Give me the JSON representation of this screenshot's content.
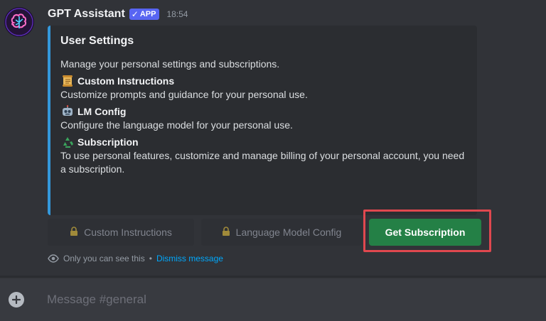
{
  "message": {
    "author": "GPT Assistant",
    "badge": "APP",
    "badge_check": "✓",
    "timestamp": "18:54"
  },
  "embed": {
    "accent_color": "#3498db",
    "title": "User Settings",
    "description": "Manage your personal settings and subscriptions.",
    "sections": [
      {
        "icon": "scroll-icon",
        "title": "Custom Instructions",
        "text": "Customize prompts and guidance for your personal use."
      },
      {
        "icon": "robot-icon",
        "title": "LM Config",
        "text": "Configure the language model for your personal use."
      },
      {
        "icon": "recycle-icon",
        "title": "Subscription",
        "text": "To use personal features, customize and manage billing of your personal account, you need a subscription."
      }
    ]
  },
  "buttons": {
    "custom_instructions": "Custom Instructions",
    "lm_config": "Language Model Config",
    "get_subscription": "Get Subscription"
  },
  "ephemeral": {
    "notice": "Only you can see this",
    "separator": "•",
    "dismiss": "Dismiss message"
  },
  "composer": {
    "placeholder": "Message #general"
  },
  "colors": {
    "background": "#313338",
    "embed_bg": "#2b2d31",
    "brand": "#5865f2",
    "success": "#248046",
    "link": "#00a8fc",
    "highlight": "#e0484f"
  }
}
